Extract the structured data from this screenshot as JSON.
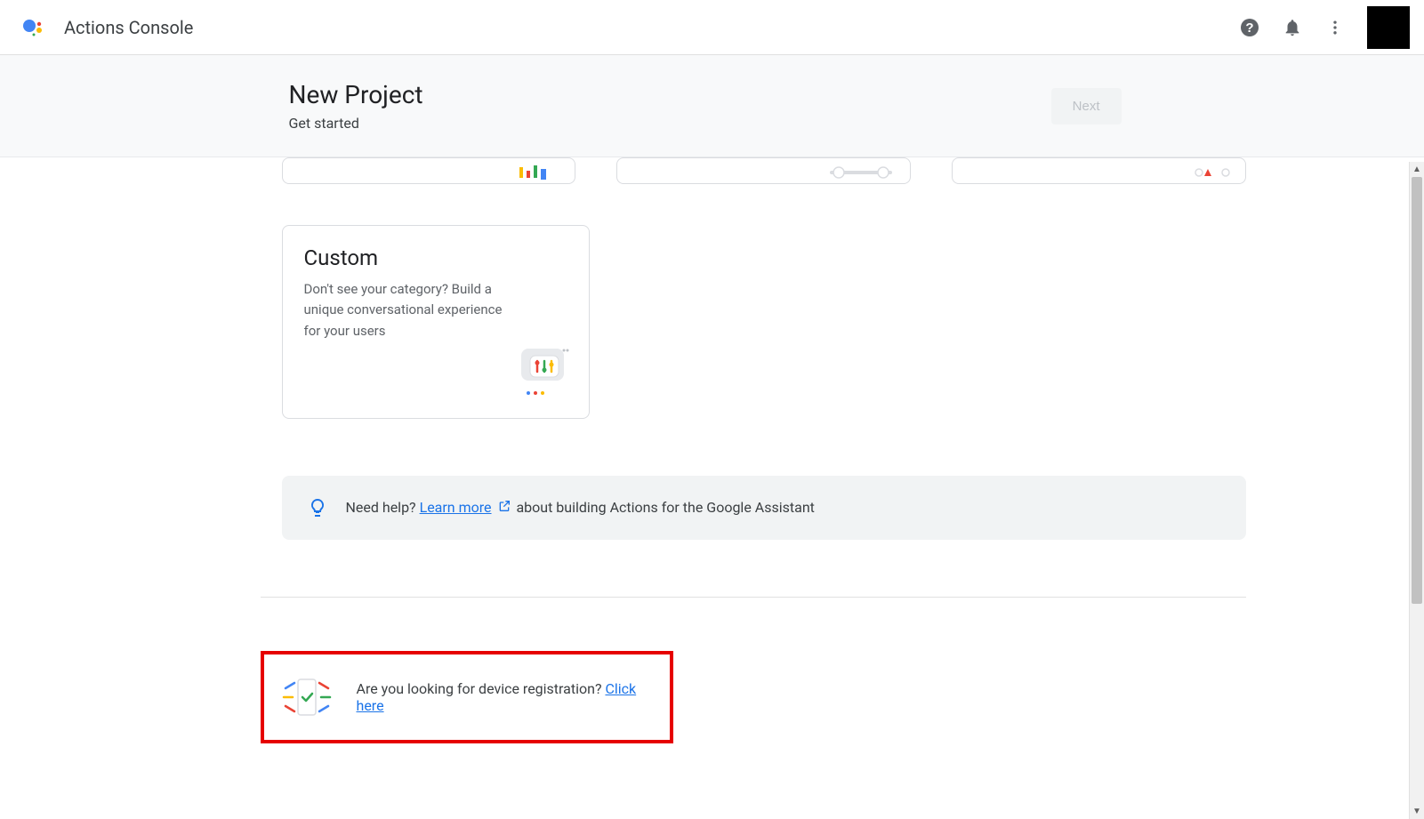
{
  "header": {
    "app_title": "Actions Console"
  },
  "subheader": {
    "title": "New Project",
    "subtitle": "Get started",
    "next_label": "Next"
  },
  "cards": {
    "custom": {
      "title": "Custom",
      "description": "Don't see your category? Build a unique conversational experience for your users"
    }
  },
  "help_banner": {
    "prefix": "Need help? ",
    "link_text": "Learn more",
    "suffix": " about building Actions for the Google Assistant"
  },
  "device_registration": {
    "prefix": "Are you looking for device registration? ",
    "link_text": "Click here"
  }
}
